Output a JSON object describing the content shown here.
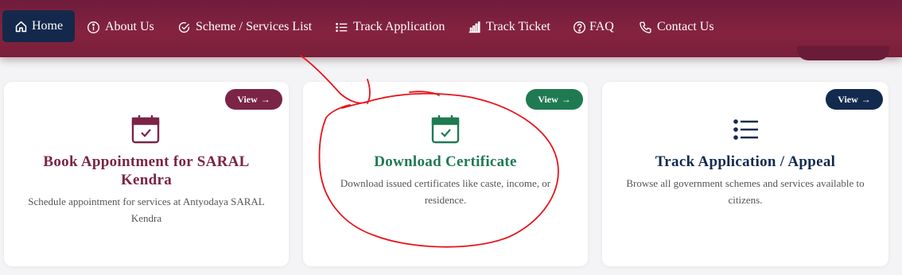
{
  "nav": {
    "items": [
      {
        "label": "Home",
        "icon": "home-icon"
      },
      {
        "label": "About Us",
        "icon": "info-icon"
      },
      {
        "label": "Scheme / Services List",
        "icon": "check-circle-icon"
      },
      {
        "label": "Track Application",
        "icon": "list-icon"
      },
      {
        "label": "Track Ticket",
        "icon": "bar-chart-icon"
      },
      {
        "label": "FAQ",
        "icon": "question-icon"
      },
      {
        "label": "Contact Us",
        "icon": "phone-icon"
      }
    ],
    "active": "Home"
  },
  "cards": [
    {
      "title_line1": "Book Appointment for SARAL",
      "title_line2": "Kendra",
      "desc_line1": "Schedule appointment for services at Antyodaya SARAL",
      "desc_line2": "Kendra",
      "view_label": "View",
      "icon": "calendar-check-icon",
      "color": "#7b2445"
    },
    {
      "title_line1": "Download Certificate",
      "desc_line1": "Download issued certificates like caste, income, or",
      "desc_line2": "residence.",
      "view_label": "View",
      "icon": "calendar-check-icon",
      "color": "#1f7a52"
    },
    {
      "title_line1": "Track Application / Appeal",
      "desc_line1": "Browse all government schemes and services available to",
      "desc_line2": "citizens.",
      "view_label": "View",
      "icon": "list-icon",
      "color": "#132a4f"
    }
  ],
  "colors": {
    "nav_bg": "#7a1f3a",
    "home_active": "#14284b",
    "annotation": "#e8141b"
  }
}
